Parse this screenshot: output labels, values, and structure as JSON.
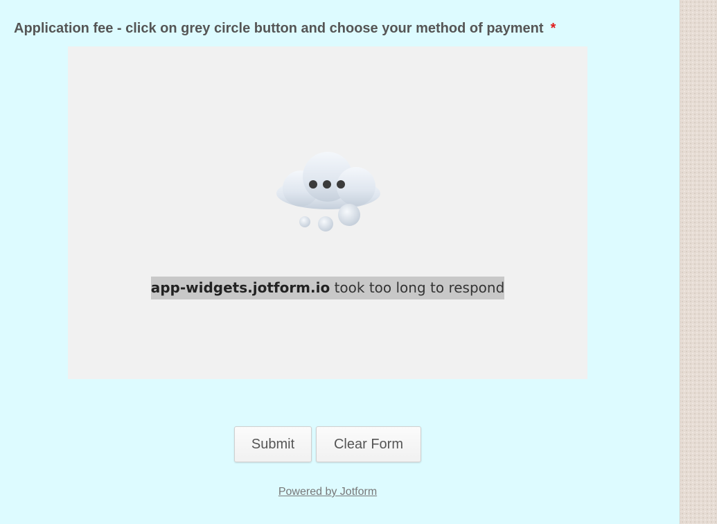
{
  "question": {
    "label": "Application fee - click on grey circle button and choose your method of payment",
    "required_mark": "*"
  },
  "widget": {
    "icon": "cloud-thinking-icon",
    "error_host": "app-widgets.jotform.io",
    "error_text": " took too long to respond"
  },
  "buttons": {
    "submit_label": "Submit",
    "clear_label": "Clear Form"
  },
  "footer": {
    "powered_by": "Powered by Jotform"
  },
  "colors": {
    "page_background": "#ddfbff",
    "frame_background": "#f1f1f1",
    "required": "#e01b1b",
    "label_text": "#555555"
  }
}
